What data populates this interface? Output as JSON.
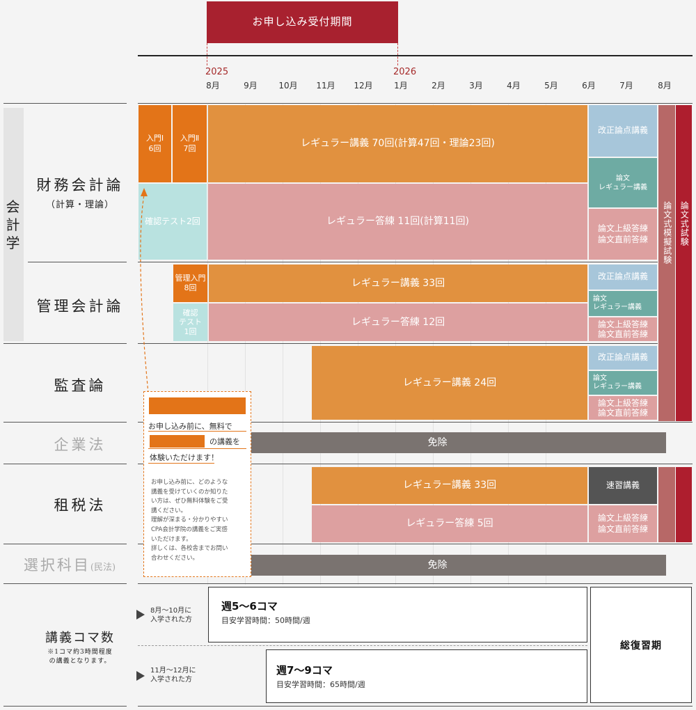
{
  "header": {
    "application_period": "お申し込み受付期間"
  },
  "timeline": {
    "year_start": "2025",
    "year_next": "2026",
    "months": [
      "8月",
      "9月",
      "10月",
      "11月",
      "12月",
      "1月",
      "2月",
      "3月",
      "4月",
      "5月",
      "6月",
      "7月",
      "8月"
    ]
  },
  "category": {
    "accounting": "会計学"
  },
  "subjects": {
    "financial": {
      "name": "財務会計論",
      "sub": "（計算・理論）"
    },
    "management": {
      "name": "管理会計論"
    },
    "audit": {
      "name": "監査論"
    },
    "corporate": {
      "name": "企業法"
    },
    "tax": {
      "name": "租税法"
    },
    "elective": {
      "name": "選択科目",
      "sub": "(民法)"
    },
    "lecture_count": {
      "name": "講義コマ数",
      "note1": "※1コマ約3時間程度",
      "note2": "の講義となります。"
    }
  },
  "blocks": {
    "fin_intro1": {
      "line1": "入門Ⅰ",
      "line2": "6回"
    },
    "fin_intro2": {
      "line1": "入門Ⅱ",
      "line2": "7回"
    },
    "fin_lecture": "レギュラー講義 70回(計算47回・理論23回)",
    "fin_check": "確認テスト2回",
    "fin_answer": "レギュラー答練 11回(計算11回)",
    "fin_revision": "改正論点講義",
    "fin_essay_reg": {
      "line1": "論文",
      "line2": "レギュラー講義"
    },
    "fin_essay_adv": {
      "line1": "論文上級答練",
      "line2": "論文直前答練"
    },
    "mock_exam": "論文式模擬試験",
    "essay_exam": "論文式試験",
    "mgmt_intro": {
      "line1": "管理入門",
      "line2": "8回"
    },
    "mgmt_check": {
      "line1": "確認",
      "line2": "テスト",
      "line3": "1回"
    },
    "mgmt_lecture": "レギュラー講義 33回",
    "mgmt_answer": "レギュラー答練 12回",
    "mgmt_revision": "改正論点講義",
    "mgmt_essay_reg": {
      "line1": "論文",
      "line2": "レギュラー講義"
    },
    "mgmt_essay_adv": {
      "line1": "論文上級答練",
      "line2": "論文直前答練"
    },
    "audit_lecture": "レギュラー講義 24回",
    "audit_revision": "改正論点講義",
    "audit_essay_reg": {
      "line1": "論文",
      "line2": "レギュラー講義"
    },
    "audit_essay_adv": {
      "line1": "論文上級答練",
      "line2": "論文直前答練"
    },
    "corp_exempt": "免除",
    "tax_lecture": "レギュラー講義 33回",
    "tax_answer": "レギュラー答練 5回",
    "tax_speed": "速習講義",
    "tax_essay_adv": {
      "line1": "論文上級答練",
      "line2": "論文直前答練"
    },
    "elective_exempt": "免除"
  },
  "popup": {
    "line1": "お申し込み前に、無料で",
    "line2": "の講義を",
    "line3": "体験いただけます！",
    "body": [
      "お申し込み前に、どのような",
      "講義を受けていくのか知りた",
      "い方は、ぜひ無料体験をご受",
      "講ください。",
      "理解が深まる・分かりやすい",
      "CPA会計学院の講義をご実感",
      "いただけます。",
      "詳しくは、各校舎までお問い",
      "合わせください。"
    ]
  },
  "schedule": {
    "group1": {
      "period_line1": "8月〜10月に",
      "period_line2": "入学された方",
      "title": "週5〜6コマ",
      "hours": "目安学習時間：50時間/週"
    },
    "group2": {
      "period_line1": "11月〜12月に",
      "period_line2": "入学された方",
      "title": "週7〜9コマ",
      "hours": "目安学習時間：65時間/週"
    },
    "review": "総復習期"
  },
  "colors": {
    "accent_red": "#ae1e2e",
    "orange": "#e1913f",
    "dark_orange": "#e37418",
    "pink": "#dda0a0",
    "teal": "#b9e2e0"
  }
}
